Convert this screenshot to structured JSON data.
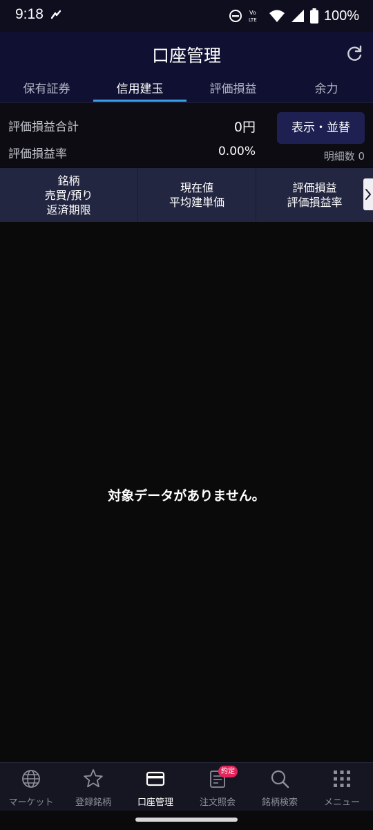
{
  "status_bar": {
    "time": "9:18",
    "battery_text": "100%",
    "icons": [
      "nfc-icon",
      "do-not-disturb-icon",
      "volte-icon",
      "wifi-icon",
      "signal-icon",
      "battery-icon"
    ],
    "volte_label": "LTE"
  },
  "header": {
    "title": "口座管理",
    "refresh_icon": "refresh-icon"
  },
  "tabs": [
    {
      "label": "保有証券",
      "active": false
    },
    {
      "label": "信用建玉",
      "active": true
    },
    {
      "label": "評価損益",
      "active": false
    },
    {
      "label": "余力",
      "active": false
    }
  ],
  "summary": {
    "total_label": "評価損益合計",
    "total_value": "0円",
    "rate_label": "評価損益率",
    "rate_value": "0.00%",
    "display_button": "表示・並替",
    "detail_count": "明細数 0"
  },
  "columns": {
    "col1": [
      "銘柄",
      "売買/預り",
      "返済期限"
    ],
    "col2": [
      "現在値",
      "平均建単価"
    ],
    "col3": [
      "評価損益",
      "評価損益率"
    ]
  },
  "empty_message": "対象データがありません。",
  "bottom_nav": [
    {
      "label": "マーケット",
      "icon": "globe-icon",
      "active": false
    },
    {
      "label": "登録銘柄",
      "icon": "star-icon",
      "active": false
    },
    {
      "label": "口座管理",
      "icon": "card-icon",
      "active": true
    },
    {
      "label": "注文照会",
      "icon": "document-icon",
      "active": false,
      "badge": "約定"
    },
    {
      "label": "銘柄検索",
      "icon": "search-icon",
      "active": false
    },
    {
      "label": "メニュー",
      "icon": "grid-menu-icon",
      "active": false
    }
  ],
  "colors": {
    "header_bg": "#101132",
    "tab_underline": "#3aa0e6",
    "button_bg": "#1e2052",
    "badge": "#e2245a"
  }
}
